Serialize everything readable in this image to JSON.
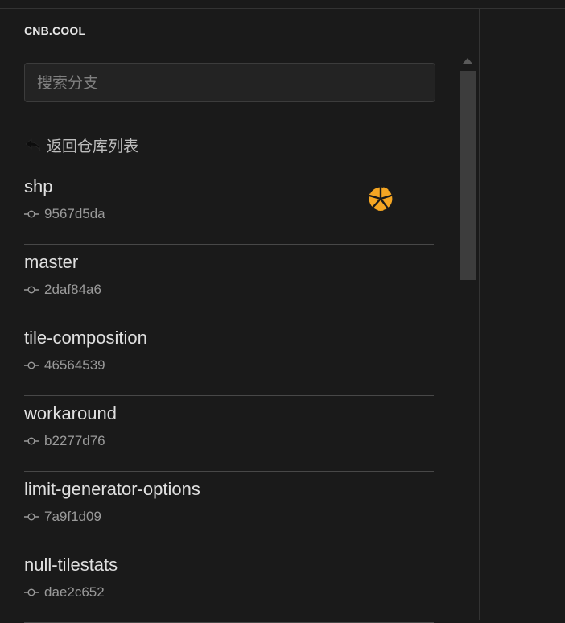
{
  "brand": "CNB.COOL",
  "search": {
    "placeholder": "搜索分支",
    "value": ""
  },
  "back": {
    "label": "返回仓库列表",
    "icon": "reply-arrow-icon"
  },
  "branches": [
    {
      "name": "shp",
      "commit": "9567d5da",
      "status_icon": "orange-spinner-icon"
    },
    {
      "name": "master",
      "commit": "2daf84a6"
    },
    {
      "name": "tile-composition",
      "commit": "46564539"
    },
    {
      "name": "workaround",
      "commit": "b2277d76"
    },
    {
      "name": "limit-generator-options",
      "commit": "7a9f1d09"
    },
    {
      "name": "null-tilestats",
      "commit": "dae2c652"
    }
  ],
  "colors": {
    "background": "#1a1a1a",
    "accent": "#f5a623",
    "text": "#e0e0e0",
    "muted": "#9a9a9a"
  }
}
